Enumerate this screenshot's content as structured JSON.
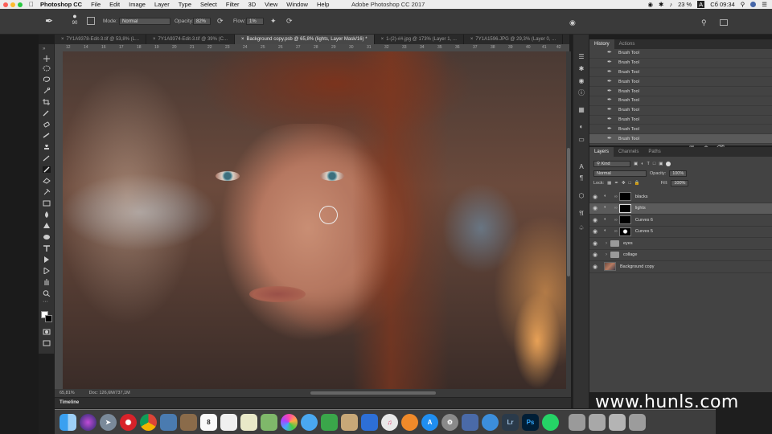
{
  "menubar": {
    "app_name": "Photoshop CC",
    "menus": [
      "File",
      "Edit",
      "Image",
      "Layer",
      "Type",
      "Select",
      "Filter",
      "3D",
      "View",
      "Window",
      "Help"
    ],
    "window_title": "Adobe Photoshop CC 2017",
    "battery": "23 %",
    "clock": "Сб 09:34",
    "keyboard_layout": "A"
  },
  "options": {
    "brush_size": "90",
    "mode_label": "Mode:",
    "mode_value": "Normal",
    "opacity_label": "Opacity:",
    "opacity_value": "82%",
    "flow_label": "Flow:",
    "flow_value": "1%"
  },
  "tabs": [
    {
      "label": "7Y1A9378-Edit-3.tif @ 53,8% (L..."
    },
    {
      "label": "7Y1A9374-Edit-3.tif @ 39% (C..."
    },
    {
      "label": "Background copy.psb @ 65,8% (lights, Layer Mask/16) *"
    },
    {
      "label": "1-(2)-##.jpg @ 173% (Layer 1, ..."
    },
    {
      "label": "7Y1A1596.JPG @ 29,3% (Layer 0, ..."
    }
  ],
  "ruler_ticks": [
    "12",
    "14",
    "16",
    "17",
    "18",
    "19",
    "20",
    "21",
    "22",
    "23",
    "24",
    "25",
    "26",
    "27",
    "28",
    "29",
    "30",
    "31",
    "32",
    "33",
    "34",
    "35",
    "36",
    "37",
    "38",
    "39",
    "40",
    "41",
    "42"
  ],
  "status": {
    "zoom": "65,81%",
    "doc": "Doc: 126,6M/737,1M"
  },
  "timeline_label": "Timeline",
  "history": {
    "tabs": [
      "History",
      "Actions"
    ],
    "items": [
      "Brush Tool",
      "Brush Tool",
      "Brush Tool",
      "Brush Tool",
      "Brush Tool",
      "Brush Tool",
      "Brush Tool",
      "Brush Tool",
      "Brush Tool",
      "Brush Tool"
    ]
  },
  "layers_panel": {
    "tabs": [
      "Layers",
      "Channels",
      "Paths"
    ],
    "kind_label": "Kind",
    "blend_mode": "Normal",
    "opacity_label": "Opacity:",
    "opacity_value": "100%",
    "lock_label": "Lock:",
    "fill_label": "Fill:",
    "fill_value": "100%",
    "layers": [
      {
        "name": "blacks"
      },
      {
        "name": "lights"
      },
      {
        "name": "Curves 6"
      },
      {
        "name": "Curves 5"
      },
      {
        "name": "eyes"
      },
      {
        "name": "collage"
      },
      {
        "name": "Background copy"
      }
    ]
  },
  "dock": {
    "apps": [
      "finder",
      "siri",
      "launchpad",
      "opera",
      "chrome",
      "preview",
      "notes",
      "calendar",
      "textedit",
      "stickies",
      "maps",
      "photos",
      "messages",
      "facetime",
      "contacts",
      "keynote",
      "itunes",
      "books",
      "appstore",
      "prefs",
      "xcode",
      "safari",
      "lightroom",
      "photoshop",
      "whatsapp",
      "downloads",
      "folder",
      "folder2",
      "trash"
    ],
    "lightroom_label": "Lr",
    "photoshop_label": "Ps",
    "calendar_day": "8"
  },
  "watermark": "www.hunls.com",
  "colors": {
    "ui_dark": "#323232",
    "panel": "#434343",
    "selected_row": "#5b5b5b",
    "photoshop_blue": "#31a8ff"
  }
}
